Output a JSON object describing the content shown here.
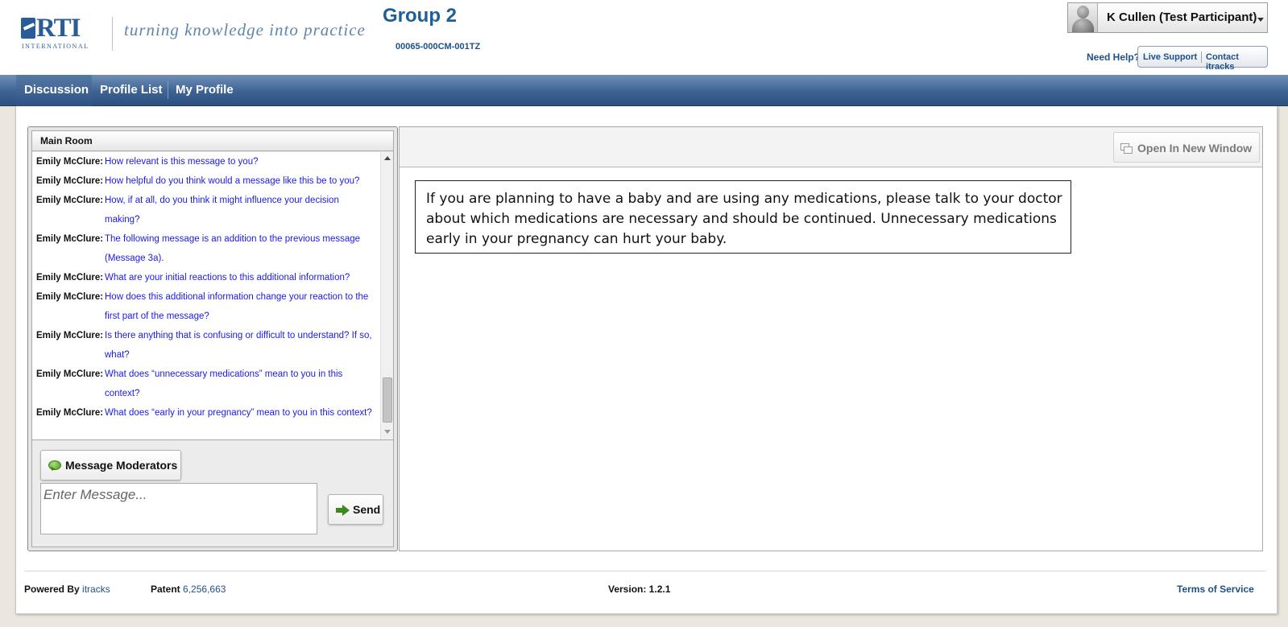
{
  "header": {
    "logo_text": "RTI",
    "logo_sub": "INTERNATIONAL",
    "tagline": "turning knowledge into practice",
    "group_title": "Group 2",
    "group_code": "00065-000CM-001TZ",
    "user_name": "K Cullen (Test Participant)",
    "need_help": "Need Help?",
    "live_support": "Live Support",
    "contact": "Contact itracks"
  },
  "nav": {
    "tabs": [
      {
        "label": "Discussion",
        "active": true
      },
      {
        "label": "Profile List",
        "active": false
      },
      {
        "label": "My Profile",
        "active": false
      }
    ]
  },
  "chat": {
    "room_title": "Main Room",
    "messages": [
      {
        "author": "Emily McClure:",
        "text": "How relevant is this message to you?"
      },
      {
        "author": "Emily McClure:",
        "text": "How helpful do you think would a message like this be to you?"
      },
      {
        "author": "Emily McClure:",
        "text": "How, if at all, do you think it might influence your decision making?"
      },
      {
        "author": "Emily McClure:",
        "text": "The following message is an addition to the previous message (Message 3a)."
      },
      {
        "author": "Emily McClure:",
        "text": "What are your initial reactions to this additional information?"
      },
      {
        "author": "Emily McClure:",
        "text": "How does this additional information change your reaction to the first part of the message?"
      },
      {
        "author": "Emily McClure:",
        "text": "Is there anything that is confusing or difficult to understand? If so, what?"
      },
      {
        "author": "Emily McClure:",
        "text": "What does “unnecessary medications” mean to you in this context?"
      },
      {
        "author": "Emily McClure:",
        "text": "What does “early in your pregnancy” mean to you in this context?"
      }
    ],
    "moderators_button": "Message Moderators",
    "input_placeholder": "Enter Message...",
    "send_button": "Send"
  },
  "content": {
    "open_window_button": "Open In New Window",
    "message": "If you are planning to have a baby and are using any medications, please talk to your doctor about which medications are necessary and should be continued. Unnecessary medications early in your pregnancy can hurt your baby."
  },
  "footer": {
    "powered_by": "Powered By",
    "powered_by_link": "itracks",
    "patent_label": "Patent",
    "patent_number": "6,256,663",
    "version": "Version: 1.2.1",
    "terms": "Terms of Service"
  },
  "colors": {
    "brand_blue": "#1f5f98",
    "nav_blue": "#3d6394",
    "message_text": "#1a1ae6"
  }
}
